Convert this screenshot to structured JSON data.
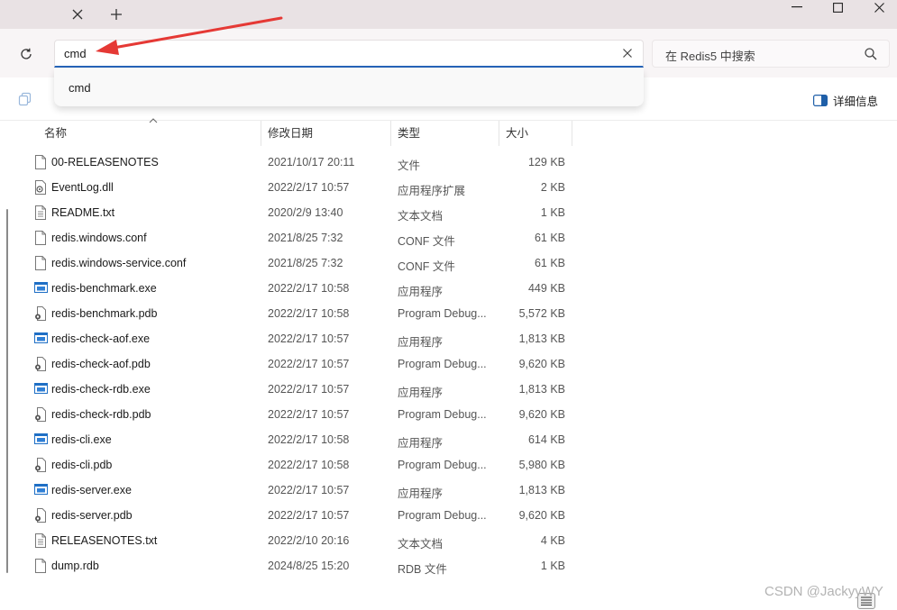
{
  "tabbar": {
    "close_glyph": "✕",
    "new_tab_glyph": "+"
  },
  "window_controls": {
    "minimize": "—",
    "maximize": "☐",
    "close": "✕"
  },
  "address": {
    "value": "cmd",
    "suggestion": "cmd"
  },
  "search": {
    "placeholder": "在 Redis5 中搜索"
  },
  "toolbar": {
    "details_label": "详细信息"
  },
  "columns": {
    "name": "名称",
    "date": "修改日期",
    "type": "类型",
    "size": "大小"
  },
  "files": [
    {
      "name": "00-RELEASENOTES",
      "date": "2021/10/17 20:11",
      "type": "文件",
      "size": "129 KB",
      "icon": "file-icon"
    },
    {
      "name": "EventLog.dll",
      "date": "2022/2/17 10:57",
      "type": "应用程序扩展",
      "size": "2 KB",
      "icon": "dll-icon"
    },
    {
      "name": "README.txt",
      "date": "2020/2/9 13:40",
      "type": "文本文档",
      "size": "1 KB",
      "icon": "text-file-icon"
    },
    {
      "name": "redis.windows.conf",
      "date": "2021/8/25 7:32",
      "type": "CONF 文件",
      "size": "61 KB",
      "icon": "file-icon"
    },
    {
      "name": "redis.windows-service.conf",
      "date": "2021/8/25 7:32",
      "type": "CONF 文件",
      "size": "61 KB",
      "icon": "file-icon"
    },
    {
      "name": "redis-benchmark.exe",
      "date": "2022/2/17 10:58",
      "type": "应用程序",
      "size": "449 KB",
      "icon": "exe-icon"
    },
    {
      "name": "redis-benchmark.pdb",
      "date": "2022/2/17 10:58",
      "type": "Program Debug...",
      "size": "5,572 KB",
      "icon": "pdb-icon"
    },
    {
      "name": "redis-check-aof.exe",
      "date": "2022/2/17 10:57",
      "type": "应用程序",
      "size": "1,813 KB",
      "icon": "exe-icon"
    },
    {
      "name": "redis-check-aof.pdb",
      "date": "2022/2/17 10:57",
      "type": "Program Debug...",
      "size": "9,620 KB",
      "icon": "pdb-icon"
    },
    {
      "name": "redis-check-rdb.exe",
      "date": "2022/2/17 10:57",
      "type": "应用程序",
      "size": "1,813 KB",
      "icon": "exe-icon"
    },
    {
      "name": "redis-check-rdb.pdb",
      "date": "2022/2/17 10:57",
      "type": "Program Debug...",
      "size": "9,620 KB",
      "icon": "pdb-icon"
    },
    {
      "name": "redis-cli.exe",
      "date": "2022/2/17 10:58",
      "type": "应用程序",
      "size": "614 KB",
      "icon": "exe-icon"
    },
    {
      "name": "redis-cli.pdb",
      "date": "2022/2/17 10:58",
      "type": "Program Debug...",
      "size": "5,980 KB",
      "icon": "pdb-icon"
    },
    {
      "name": "redis-server.exe",
      "date": "2022/2/17 10:57",
      "type": "应用程序",
      "size": "1,813 KB",
      "icon": "exe-icon"
    },
    {
      "name": "redis-server.pdb",
      "date": "2022/2/17 10:57",
      "type": "Program Debug...",
      "size": "9,620 KB",
      "icon": "pdb-icon"
    },
    {
      "name": "RELEASENOTES.txt",
      "date": "2022/2/10 20:16",
      "type": "文本文档",
      "size": "4 KB",
      "icon": "text-file-icon"
    },
    {
      "name": "dump.rdb",
      "date": "2024/8/25 15:20",
      "type": "RDB 文件",
      "size": "1 KB",
      "icon": "file-icon"
    }
  ],
  "watermark": "CSDN @JackyyWY",
  "colors": {
    "accent": "#2664b8",
    "arrow": "#e53935",
    "exe_blue": "#1f6fc5"
  }
}
